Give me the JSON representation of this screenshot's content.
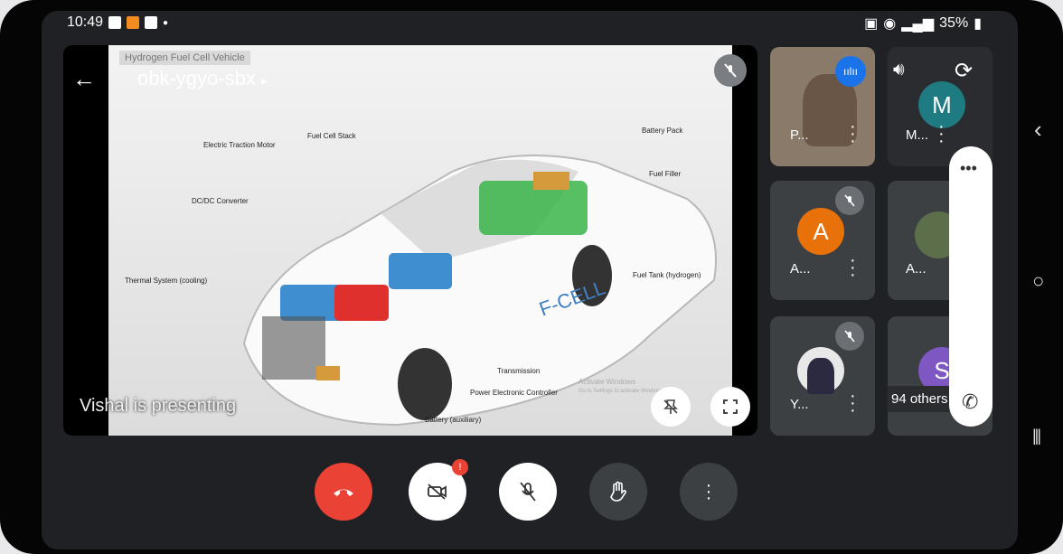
{
  "status": {
    "time": "10:49",
    "battery": "35%"
  },
  "meeting": {
    "code": "obk-ygyo-sbx",
    "presenter_text": "Vishal is presenting"
  },
  "slide": {
    "title": "Hydrogen Fuel Cell Vehicle",
    "labels": [
      "Fuel Cell Stack",
      "Battery Pack",
      "Electric Traction Motor",
      "Fuel Filler",
      "DC/DC Converter",
      "Thermal System (cooling)",
      "Fuel Tank (hydrogen)",
      "Transmission",
      "Power Electronic Controller",
      "Battery (auxiliary)"
    ],
    "watermark_line1": "Activate Windows",
    "watermark_line2": "Go to Settings to activate Windows."
  },
  "participants": [
    {
      "name": "P...",
      "type": "video"
    },
    {
      "name": "M...",
      "initial": "M",
      "color": "#1e7b82"
    },
    {
      "name": "A...",
      "initial": "A",
      "color": "#e8710a"
    },
    {
      "name": "A...",
      "type": "photo"
    },
    {
      "name": "Y...",
      "type": "photo"
    },
    {
      "name": "94 others",
      "initial": "S",
      "color": "#7e57c2"
    }
  ],
  "controls": [
    "end-call",
    "camera-off",
    "mic-off",
    "raise-hand",
    "more-options"
  ],
  "camera_badge": "!",
  "colors": {
    "end_call": "#ea4335",
    "tile": "#3c4043",
    "background": "#202124"
  }
}
